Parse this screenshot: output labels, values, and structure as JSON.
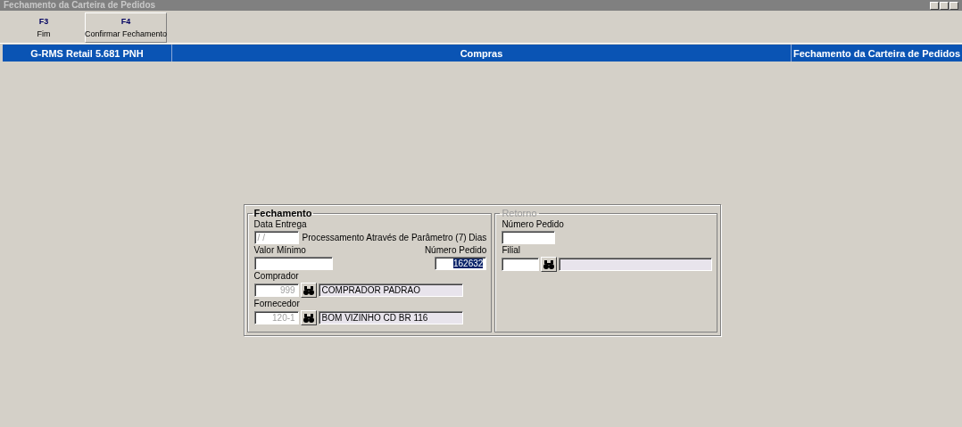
{
  "window": {
    "title": "Fechamento da Carteira de Pedidos"
  },
  "toolbar": [
    {
      "key": "F3",
      "label": "Fim",
      "raised": false
    },
    {
      "key": "F4",
      "label": "Confirmar Fechamento",
      "raised": true
    }
  ],
  "header": [
    "G-RMS Retail 5.681 PNH",
    "Compras",
    "Fechamento da Carteira de Pedidos"
  ],
  "fechamento": {
    "title": "Fechamento",
    "disabled": false,
    "data_entrega": {
      "label": "Data Entrega",
      "value": "/ /",
      "disabled": true
    },
    "note": "Processamento Através de Parâmetro (7) Dias",
    "valor_minimo": {
      "label": "Valor Mínimo"
    },
    "numero_pedido": {
      "label": "Número Pedido",
      "value": "162632",
      "highlighted": true
    },
    "comprador": {
      "label": "Comprador",
      "code": "999",
      "name": "COMPRADOR PADRAO"
    },
    "fornecedor": {
      "label": "Fornecedor",
      "code": "120-1",
      "name": "BOM VIZINHO CD BR 116"
    }
  },
  "retorno": {
    "title": "Retorno",
    "disabled": true,
    "numero_pedido": {
      "label": "Número Pedido"
    },
    "filial": {
      "label": "Filial"
    }
  }
}
